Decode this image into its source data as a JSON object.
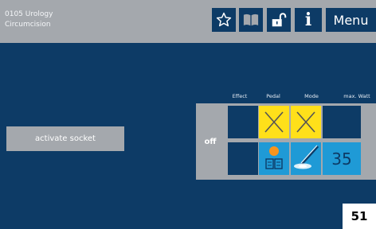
{
  "header": {
    "program_line1": "0105 Urology",
    "program_line2": "Circumcision",
    "menu_label": "Menu",
    "info_label": "i"
  },
  "icons": {
    "favorite": "star-icon",
    "library": "book-icon",
    "lock": "unlock-icon"
  },
  "activate_socket_label": "activate socket",
  "columns": {
    "effect": "Effect",
    "pedal": "Pedal",
    "mode": "Mode",
    "max_watt": "max. Watt"
  },
  "rows": {
    "off_label": "off",
    "max_watt_value": "35"
  },
  "page_number": "51",
  "colors": {
    "panel_background": "#0d3b66",
    "header_gray": "#a4a8ad",
    "highlight_yellow": "#ffe01a",
    "mode_blue": "#1f9ad6",
    "pedal_orange": "#f7941d"
  }
}
